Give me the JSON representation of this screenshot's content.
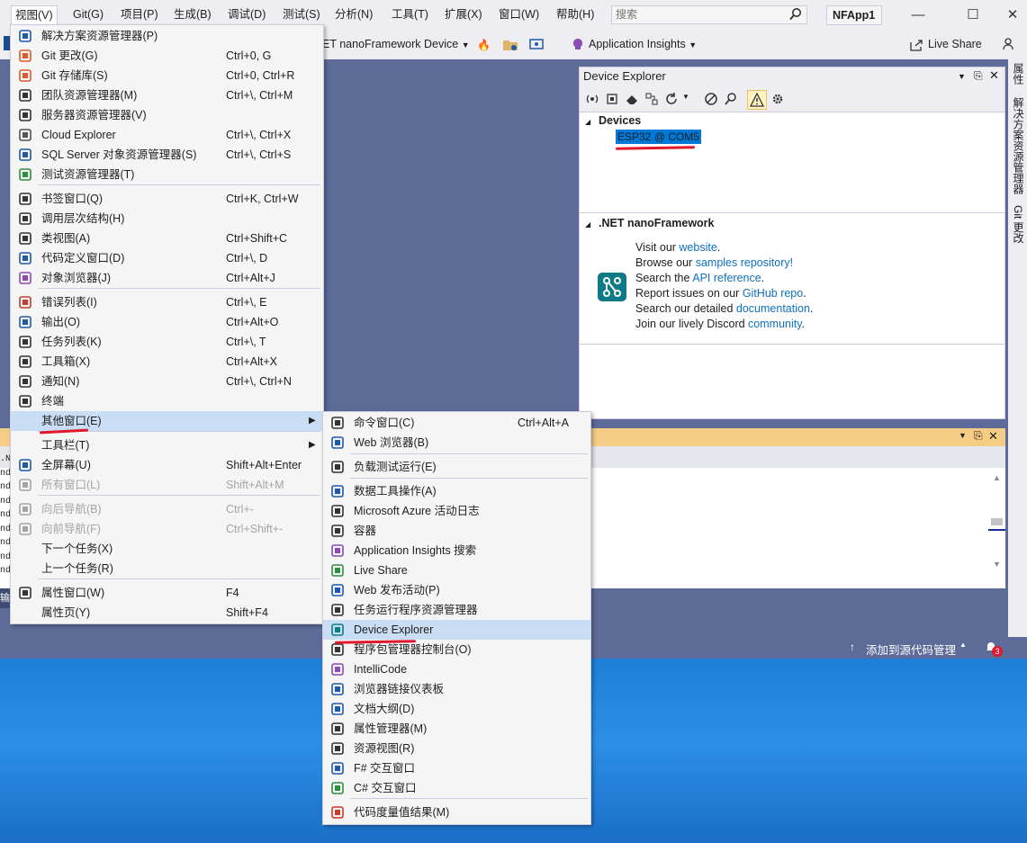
{
  "menubar": {
    "items": [
      "视图(V)",
      "Git(G)",
      "项目(P)",
      "生成(B)",
      "调试(D)",
      "测试(S)",
      "分析(N)",
      "工具(T)",
      "扩展(X)",
      "窗口(W)",
      "帮助(H)"
    ],
    "search_placeholder": "搜索",
    "project_name": "NFApp1"
  },
  "toolbar": {
    "device_target": "ET nanoFramework Device",
    "app_insights": "Application Insights",
    "live_share": "Live Share"
  },
  "right_tabs": [
    "属性",
    "解决方案资源管理器",
    "Git 更改"
  ],
  "device_explorer": {
    "title": "Device Explorer",
    "devices_header": "Devices",
    "device": "ESP32 @ COM5",
    "nf_header": ".NET nanoFramework",
    "lines": [
      {
        "pre": "Visit our ",
        "link": "website",
        "post": "."
      },
      {
        "pre": "Browse our ",
        "link": "samples repository!",
        "post": ""
      },
      {
        "pre": "Search the ",
        "link": "API reference",
        "post": "."
      },
      {
        "pre": "Report issues on our ",
        "link": "GitHub repo",
        "post": "."
      },
      {
        "pre": "Search our detailed ",
        "link": "documentation",
        "post": "."
      },
      {
        "pre": "Join our lively Discord ",
        "link": "community",
        "post": "."
      }
    ]
  },
  "output_left_snippets": [
    ".N",
    "nd",
    "nd",
    "nd",
    "nd",
    "nd",
    "nd",
    "nd",
    "nd",
    "输"
  ],
  "statusbar": {
    "source_control": "添加到源代码管理",
    "notifications": "3"
  },
  "view_menu": {
    "items": [
      {
        "label": "解决方案资源管理器(P)",
        "shortcut": "",
        "icon": "solution-explorer-icon"
      },
      {
        "label": "Git 更改(G)",
        "shortcut": "Ctrl+0, G",
        "icon": "git-changes-icon"
      },
      {
        "label": "Git 存储库(S)",
        "shortcut": "Ctrl+0, Ctrl+R",
        "icon": "git-repository-icon"
      },
      {
        "label": "团队资源管理器(M)",
        "shortcut": "Ctrl+\\, Ctrl+M",
        "icon": "team-explorer-icon"
      },
      {
        "label": "服务器资源管理器(V)",
        "shortcut": "",
        "icon": "server-explorer-icon"
      },
      {
        "label": "Cloud Explorer",
        "shortcut": "Ctrl+\\, Ctrl+X",
        "icon": "cloud-icon"
      },
      {
        "label": "SQL Server 对象资源管理器(S)",
        "shortcut": "Ctrl+\\, Ctrl+S",
        "icon": "sql-server-icon"
      },
      {
        "label": "测试资源管理器(T)",
        "shortcut": "",
        "icon": "test-explorer-icon"
      },
      {
        "label": "书签窗口(Q)",
        "shortcut": "Ctrl+K, Ctrl+W",
        "icon": "bookmark-icon"
      },
      {
        "label": "调用层次结构(H)",
        "shortcut": "",
        "icon": "call-hierarchy-icon"
      },
      {
        "label": "类视图(A)",
        "shortcut": "Ctrl+Shift+C",
        "icon": "class-view-icon"
      },
      {
        "label": "代码定义窗口(D)",
        "shortcut": "Ctrl+\\, D",
        "icon": "code-definition-icon"
      },
      {
        "label": "对象浏览器(J)",
        "shortcut": "Ctrl+Alt+J",
        "icon": "object-browser-icon"
      },
      {
        "label": "错误列表(I)",
        "shortcut": "Ctrl+\\, E",
        "icon": "error-list-icon"
      },
      {
        "label": "输出(O)",
        "shortcut": "Ctrl+Alt+O",
        "icon": "output-icon"
      },
      {
        "label": "任务列表(K)",
        "shortcut": "Ctrl+\\, T",
        "icon": "task-list-icon"
      },
      {
        "label": "工具箱(X)",
        "shortcut": "Ctrl+Alt+X",
        "icon": "toolbox-icon"
      },
      {
        "label": "通知(N)",
        "shortcut": "Ctrl+\\, Ctrl+N",
        "icon": "bell-icon"
      },
      {
        "label": "终端",
        "shortcut": "",
        "icon": "terminal-icon"
      },
      {
        "label": "其他窗口(E)",
        "shortcut": "",
        "icon": ""
      },
      {
        "label": "工具栏(T)",
        "shortcut": "",
        "icon": ""
      },
      {
        "label": "全屏幕(U)",
        "shortcut": "Shift+Alt+Enter",
        "icon": "fullscreen-icon"
      },
      {
        "label": "所有窗口(L)",
        "shortcut": "Shift+Alt+M",
        "icon": "all-windows-icon"
      },
      {
        "label": "向后导航(B)",
        "shortcut": "Ctrl+-",
        "icon": "navigate-back-icon"
      },
      {
        "label": "向前导航(F)",
        "shortcut": "Ctrl+Shift+-",
        "icon": "navigate-forward-icon"
      },
      {
        "label": "下一个任务(X)",
        "shortcut": "",
        "icon": ""
      },
      {
        "label": "上一个任务(R)",
        "shortcut": "",
        "icon": ""
      },
      {
        "label": "属性窗口(W)",
        "shortcut": "F4",
        "icon": "wrench-icon"
      },
      {
        "label": "属性页(Y)",
        "shortcut": "Shift+F4",
        "icon": ""
      }
    ]
  },
  "other_windows_menu": {
    "items": [
      {
        "label": "命令窗口(C)",
        "shortcut": "Ctrl+Alt+A",
        "icon": "command-window-icon"
      },
      {
        "label": "Web 浏览器(B)",
        "shortcut": "",
        "icon": "web-browser-icon"
      },
      {
        "label": "负载测试运行(E)",
        "shortcut": "",
        "icon": "load-test-icon"
      },
      {
        "label": "数据工具操作(A)",
        "shortcut": "",
        "icon": "data-tools-icon"
      },
      {
        "label": "Microsoft Azure 活动日志",
        "shortcut": "",
        "icon": "azure-log-icon"
      },
      {
        "label": "容器",
        "shortcut": "",
        "icon": "container-icon"
      },
      {
        "label": "Application Insights 搜索",
        "shortcut": "",
        "icon": "app-insights-icon"
      },
      {
        "label": "Live Share",
        "shortcut": "",
        "icon": "live-share-icon"
      },
      {
        "label": "Web 发布活动(P)",
        "shortcut": "",
        "icon": "web-publish-icon"
      },
      {
        "label": "任务运行程序资源管理器",
        "shortcut": "",
        "icon": "task-runner-icon"
      },
      {
        "label": "Device Explorer",
        "shortcut": "",
        "icon": "device-explorer-icon"
      },
      {
        "label": "程序包管理器控制台(O)",
        "shortcut": "",
        "icon": "package-manager-icon"
      },
      {
        "label": "IntelliCode",
        "shortcut": "",
        "icon": "intellicode-icon"
      },
      {
        "label": "浏览器链接仪表板",
        "shortcut": "",
        "icon": "browser-link-icon"
      },
      {
        "label": "文档大纲(D)",
        "shortcut": "",
        "icon": "document-outline-icon"
      },
      {
        "label": "属性管理器(M)",
        "shortcut": "",
        "icon": "property-manager-icon"
      },
      {
        "label": "资源视图(R)",
        "shortcut": "",
        "icon": "resource-view-icon"
      },
      {
        "label": "F# 交互窗口",
        "shortcut": "",
        "icon": "fsharp-interactive-icon"
      },
      {
        "label": "C# 交互窗口",
        "shortcut": "",
        "icon": "csharp-interactive-icon"
      },
      {
        "label": "代码度量值结果(M)",
        "shortcut": "",
        "icon": "code-metrics-icon"
      }
    ]
  }
}
